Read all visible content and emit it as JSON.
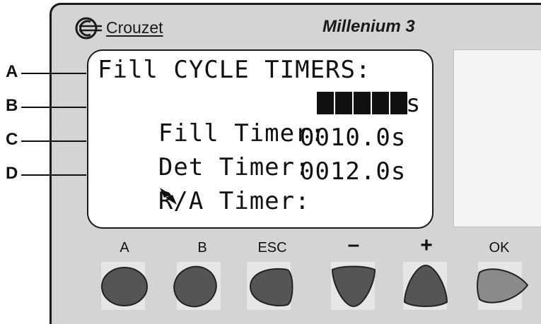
{
  "brand": {
    "name": "Crouzet",
    "model": "Millenium 3"
  },
  "lcd": {
    "title": "Fill CYCLE TIMERS:",
    "rows": [
      {
        "label": "Fill Timer:",
        "value": "",
        "unit": "s"
      },
      {
        "label": "Det Timer:",
        "value": "0010.0s"
      },
      {
        "label": "R/A Timer:",
        "value": "0012.0s"
      }
    ]
  },
  "callouts": [
    "A",
    "B",
    "C",
    "D"
  ],
  "keys": [
    {
      "label": "A"
    },
    {
      "label": "B"
    },
    {
      "label": "ESC"
    },
    {
      "label": "–"
    },
    {
      "label": "+"
    },
    {
      "label": "OK"
    }
  ],
  "colors": {
    "panel": "#d4d4d4",
    "button": "#555555",
    "ok_button": "#8a8a8a",
    "lcd_text": "#111111"
  },
  "icons": {
    "logo": "crouzet-logo-icon",
    "cursor": "up-down-arrow-icon"
  }
}
